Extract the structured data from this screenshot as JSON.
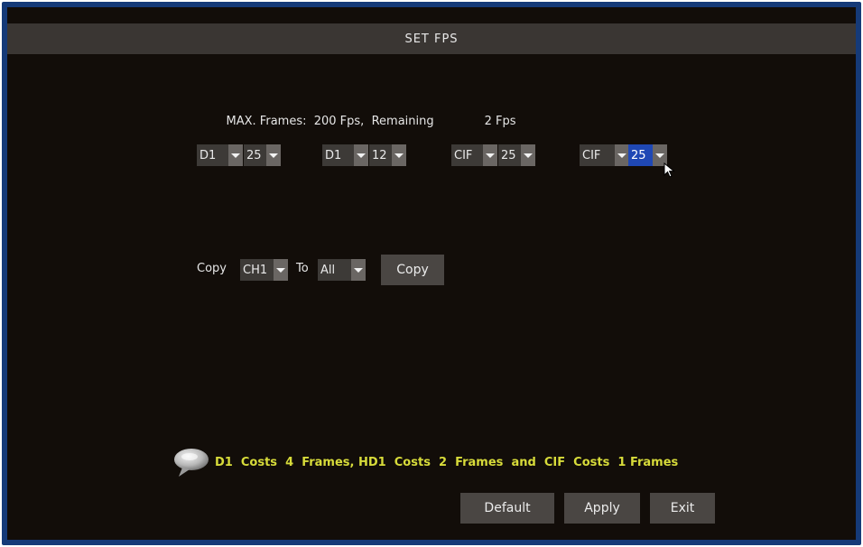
{
  "window": {
    "title": "SET FPS"
  },
  "info": {
    "max_label": "MAX. Frames:",
    "max_value": "200 Fps,",
    "remaining_label": "Remaining",
    "remaining_value": "2 Fps"
  },
  "channels": [
    {
      "resolution": "D1",
      "fps": "25"
    },
    {
      "resolution": "D1",
      "fps": "12"
    },
    {
      "resolution": "CIF",
      "fps": "25"
    },
    {
      "resolution": "CIF",
      "fps": "25",
      "focused": true
    }
  ],
  "copy": {
    "label": "Copy",
    "from": "CH1",
    "to_label": "To",
    "to": "All",
    "button": "Copy"
  },
  "hint": {
    "text": "D1  Costs  4  Frames, HD1  Costs  2  Frames  and  CIF  Costs  1 Frames"
  },
  "buttons": {
    "default": "Default",
    "apply": "Apply",
    "exit": "Exit"
  },
  "colors": {
    "border": "#153a78",
    "background": "#120d09",
    "titlebar": "#3a3633",
    "hint_text": "#d7db3a",
    "focus": "#1f48b5"
  },
  "icons": {
    "hint": "speech-bubble-icon",
    "dropdown": "dropdown-arrow-icon",
    "cursor": "mouse-cursor-icon"
  }
}
